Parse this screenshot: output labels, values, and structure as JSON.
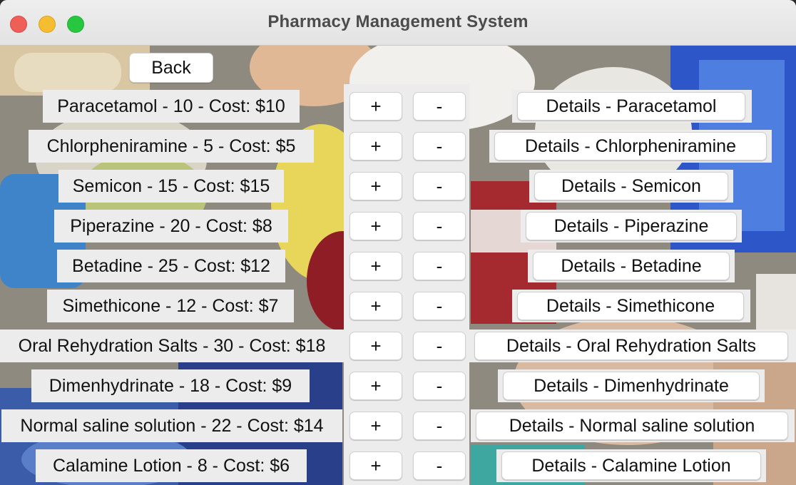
{
  "window": {
    "title": "Pharmacy Management System"
  },
  "toolbar": {
    "back_label": "Back"
  },
  "medicines": [
    {
      "label": "Paracetamol - 10 - Cost: $10",
      "plus": "+",
      "minus": "-",
      "details": "Details - Paracetamol"
    },
    {
      "label": "Chlorpheniramine - 5 - Cost: $5",
      "plus": "+",
      "minus": "-",
      "details": "Details - Chlorpheniramine"
    },
    {
      "label": "Semicon - 15 - Cost: $15",
      "plus": "+",
      "minus": "-",
      "details": "Details - Semicon"
    },
    {
      "label": "Piperazine - 20 - Cost: $8",
      "plus": "+",
      "minus": "-",
      "details": "Details - Piperazine"
    },
    {
      "label": "Betadine - 25 - Cost: $12",
      "plus": "+",
      "minus": "-",
      "details": "Details - Betadine"
    },
    {
      "label": "Simethicone - 12 - Cost: $7",
      "plus": "+",
      "minus": "-",
      "details": "Details - Simethicone"
    },
    {
      "label": "Oral Rehydration Salts - 30 - Cost: $18",
      "plus": "+",
      "minus": "-",
      "details": "Details - Oral Rehydration Salts"
    },
    {
      "label": "Dimenhydrinate - 18 - Cost: $9",
      "plus": "+",
      "minus": "-",
      "details": "Details - Dimenhydrinate"
    },
    {
      "label": "Normal saline solution - 22 - Cost: $14",
      "plus": "+",
      "minus": "-",
      "details": "Details - Normal saline solution"
    },
    {
      "label": "Calamine Lotion - 8 - Cost: $6",
      "plus": "+",
      "minus": "-",
      "details": "Details - Calamine Lotion"
    }
  ],
  "colors": {
    "close": "#ee5f57",
    "minimize": "#f5bd30",
    "maximize": "#28c740",
    "label_bg": "#ececec",
    "button_bg": "#ffffff"
  }
}
